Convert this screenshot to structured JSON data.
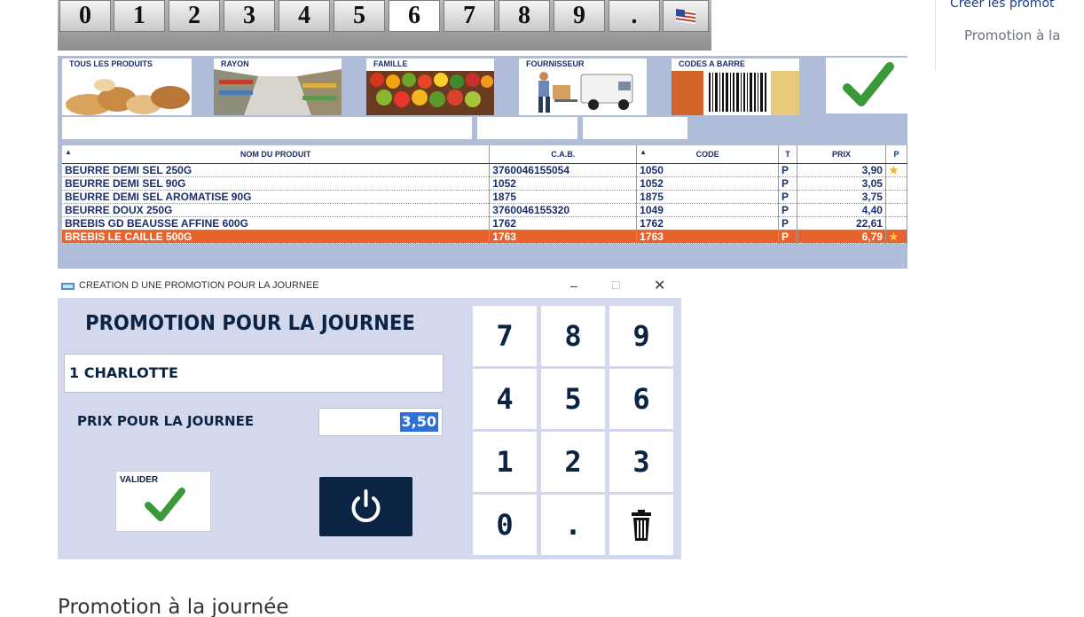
{
  "keypad_top": {
    "keys": [
      "0",
      "1",
      "2",
      "3",
      "4",
      "5",
      "6",
      "7",
      "8",
      "9",
      "."
    ],
    "flag_icon": "flag-icon"
  },
  "categories": [
    {
      "label": "TOUS LES PRODUITS"
    },
    {
      "label": "RAYON"
    },
    {
      "label": "FAMILLE"
    },
    {
      "label": "FOURNISSEUR"
    },
    {
      "label": "CODES A BARRE"
    }
  ],
  "table": {
    "headers": {
      "name": "NOM DU PRODUIT",
      "cab": "C.A.B.",
      "code": "CODE",
      "t": "T",
      "prix": "PRIX",
      "p": "P"
    },
    "rows": [
      {
        "name": "BEURRE DEMI SEL 250G",
        "cab": "3760046155054",
        "code": "1050",
        "t": "P",
        "prix": "3,90",
        "star": true
      },
      {
        "name": "BEURRE DEMI SEL 90G",
        "cab": "1052",
        "code": "1052",
        "t": "P",
        "prix": "3,05",
        "star": false
      },
      {
        "name": "BEURRE DEMI SEL AROMATISE 90G",
        "cab": "1875",
        "code": "1875",
        "t": "P",
        "prix": "3,75",
        "star": false
      },
      {
        "name": "BEURRE DOUX 250G",
        "cab": "3760046155320",
        "code": "1049",
        "t": "P",
        "prix": "4,40",
        "star": false
      },
      {
        "name": "BREBIS GD BEAUSSE AFFINE 600G",
        "cab": "1762",
        "code": "1762",
        "t": "P",
        "prix": "22,61",
        "star": false
      },
      {
        "name": "BREBIS LE CAILLE 500G",
        "cab": "1763",
        "code": "1763",
        "t": "P",
        "prix": "6,79",
        "star": true,
        "selected": true
      }
    ]
  },
  "dialog": {
    "title": "CREATION D UNE PROMOTION POUR LA JOURNEE",
    "heading": "PROMOTION POUR LA JOURNEE",
    "product_value": "1 CHARLOTTE",
    "price_label": "PRIX POUR LA JOURNEE",
    "price_value": "3,50",
    "validate_label": "VALIDER",
    "keypad": [
      "7",
      "8",
      "9",
      "4",
      "5",
      "6",
      "1",
      "2",
      "3",
      "0",
      "."
    ]
  },
  "sidebar": {
    "link": "Créer les promot",
    "item": "Promotion à la"
  },
  "caption": "Promotion à la journée",
  "colors": {
    "accent": "#e8632c",
    "navy": "#0c2444",
    "check": "#3a9a3a"
  }
}
